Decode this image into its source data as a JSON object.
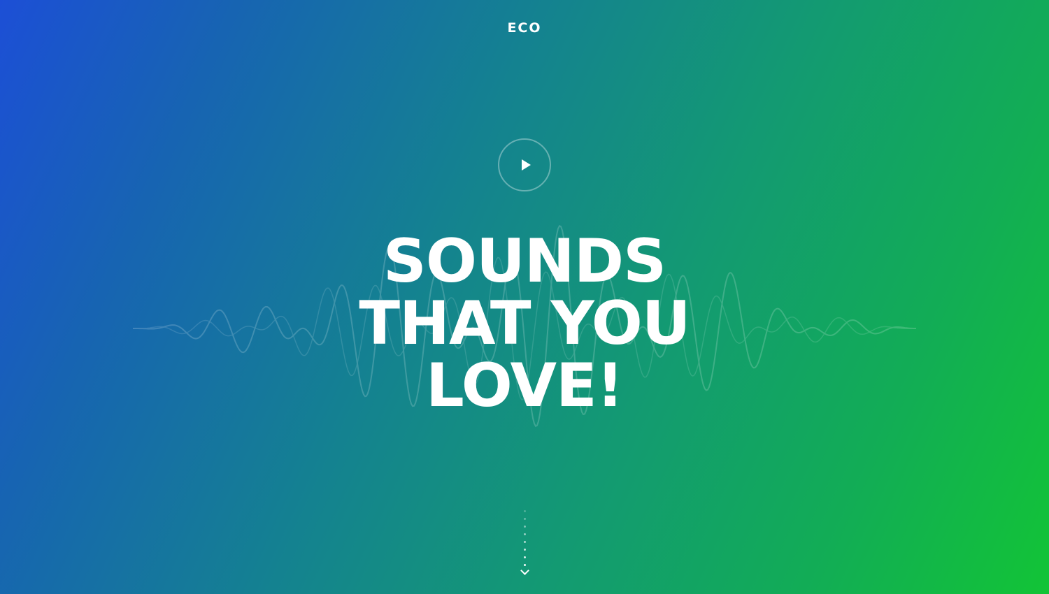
{
  "header": {
    "logo_text": "ECO"
  },
  "hero": {
    "play_label": "Play",
    "headline_lines": [
      "SOUNDS",
      "THAT YOU",
      "LOVE!"
    ]
  },
  "scroll": {
    "label": "Scroll down"
  },
  "colors": {
    "gradient_start": "#1c4fd6",
    "gradient_mid": "#14838f",
    "gradient_end": "#12c436",
    "text": "#ffffff"
  },
  "icons": {
    "play": "play-icon",
    "scroll": "chevron-down-icon",
    "background": "sound-wave-icon"
  }
}
